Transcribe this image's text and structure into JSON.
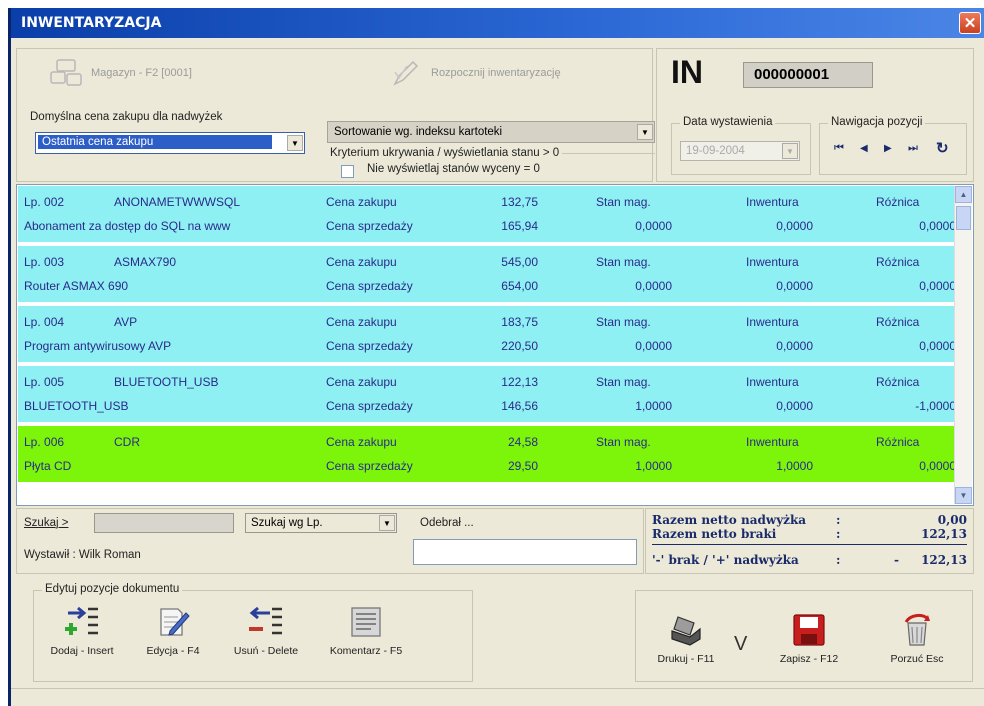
{
  "window": {
    "title": "INWENTARYZACJA",
    "close_label": "✕"
  },
  "toolbar": {
    "magazyn_label": "Magazyn - F2 [0001]",
    "rozpocznij_label": "Rozpocznij inwentaryzację"
  },
  "document": {
    "type_label": "IN",
    "number": "000000001"
  },
  "price_group": {
    "caption": "Domyślna cena zakupu dla nadwyżek",
    "selected": "Ostatnia cena zakupu"
  },
  "sort": {
    "selected": "Sortowanie wg. indeksu kartoteki"
  },
  "criteria": {
    "caption": "Kryterium ukrywania / wyświetlania stanu > 0",
    "checkbox_label": "Nie wyświetlaj stanów wyceny = 0"
  },
  "date": {
    "caption": "Data wystawienia",
    "value": "19-09-2004"
  },
  "navigation": {
    "caption": "Nawigacja pozycji",
    "first": "⏮",
    "prev": "◀",
    "next": "▶",
    "last": "⏭",
    "refresh": "↻"
  },
  "rows": [
    {
      "lp": "Lp. 002",
      "code": "ANONAMETWWWSQL",
      "name": "Abonament za dostęp do SQL na www",
      "buy_label": "Cena zakupu",
      "sell_label": "Cena sprzedaży",
      "buy": "132,75",
      "sell": "165,94",
      "stan_label": "Stan mag.",
      "stan": "0,0000",
      "inw_label": "Inwentura",
      "inw": "0,0000",
      "roz_label": "Różnica",
      "roz": "0,0000"
    },
    {
      "lp": "Lp. 003",
      "code": "ASMAX790",
      "name": "Router ASMAX 690",
      "buy_label": "Cena zakupu",
      "sell_label": "Cena sprzedaży",
      "buy": "545,00",
      "sell": "654,00",
      "stan_label": "Stan mag.",
      "stan": "0,0000",
      "inw_label": "Inwentura",
      "inw": "0,0000",
      "roz_label": "Różnica",
      "roz": "0,0000"
    },
    {
      "lp": "Lp. 004",
      "code": "AVP",
      "name": "Program antywirusowy AVP",
      "buy_label": "Cena zakupu",
      "sell_label": "Cena sprzedaży",
      "buy": "183,75",
      "sell": "220,50",
      "stan_label": "Stan mag.",
      "stan": "0,0000",
      "inw_label": "Inwentura",
      "inw": "0,0000",
      "roz_label": "Różnica",
      "roz": "0,0000"
    },
    {
      "lp": "Lp. 005",
      "code": "BLUETOOTH_USB",
      "name": "BLUETOOTH_USB",
      "buy_label": "Cena zakupu",
      "sell_label": "Cena sprzedaży",
      "buy": "122,13",
      "sell": "146,56",
      "stan_label": "Stan mag.",
      "stan": "1,0000",
      "inw_label": "Inwentura",
      "inw": "0,0000",
      "roz_label": "Różnica",
      "roz": "-1,0000"
    },
    {
      "lp": "Lp. 006",
      "code": "CDR",
      "name": "Płyta CD",
      "buy_label": "Cena zakupu",
      "sell_label": "Cena sprzedaży",
      "buy": "24,58",
      "sell": "29,50",
      "stan_label": "Stan mag.",
      "stan": "1,0000",
      "inw_label": "Inwentura",
      "inw": "1,0000",
      "roz_label": "Różnica",
      "roz": "0,0000"
    }
  ],
  "search": {
    "label": "Szukaj >",
    "value": "",
    "mode": "Szukaj wg Lp.",
    "odebral_label": "Odebrał ...",
    "odebral_value": ""
  },
  "issuer": {
    "label": "Wystawił : Wilk Roman"
  },
  "totals": {
    "nadwyzka_label": "Razem netto nadwyżka",
    "nadwyzka": "0,00",
    "braki_label": "Razem netto braki",
    "braki": "122,13",
    "diff_label": "'-' brak / '+' nadwyżka",
    "diff_sign": "-",
    "diff": "122,13",
    "colon": ":"
  },
  "edit_group": {
    "caption": "Edytuj pozycje dokumentu",
    "dodaj": "Dodaj - Insert",
    "edycja": "Edycja - F4",
    "usun": "Usuń - Delete",
    "komentarz": "Komentarz - F5"
  },
  "actions": {
    "drukuj": "Drukuj - F11",
    "v": "V",
    "zapisz": "Zapisz - F12",
    "porzuc": "Porzuć Esc"
  },
  "colors": {
    "row_normal": "#8ef0f2",
    "row_selected": "#7cf50a",
    "title_bar": "#0a3ea8",
    "totals_text": "#1a2a6a"
  }
}
